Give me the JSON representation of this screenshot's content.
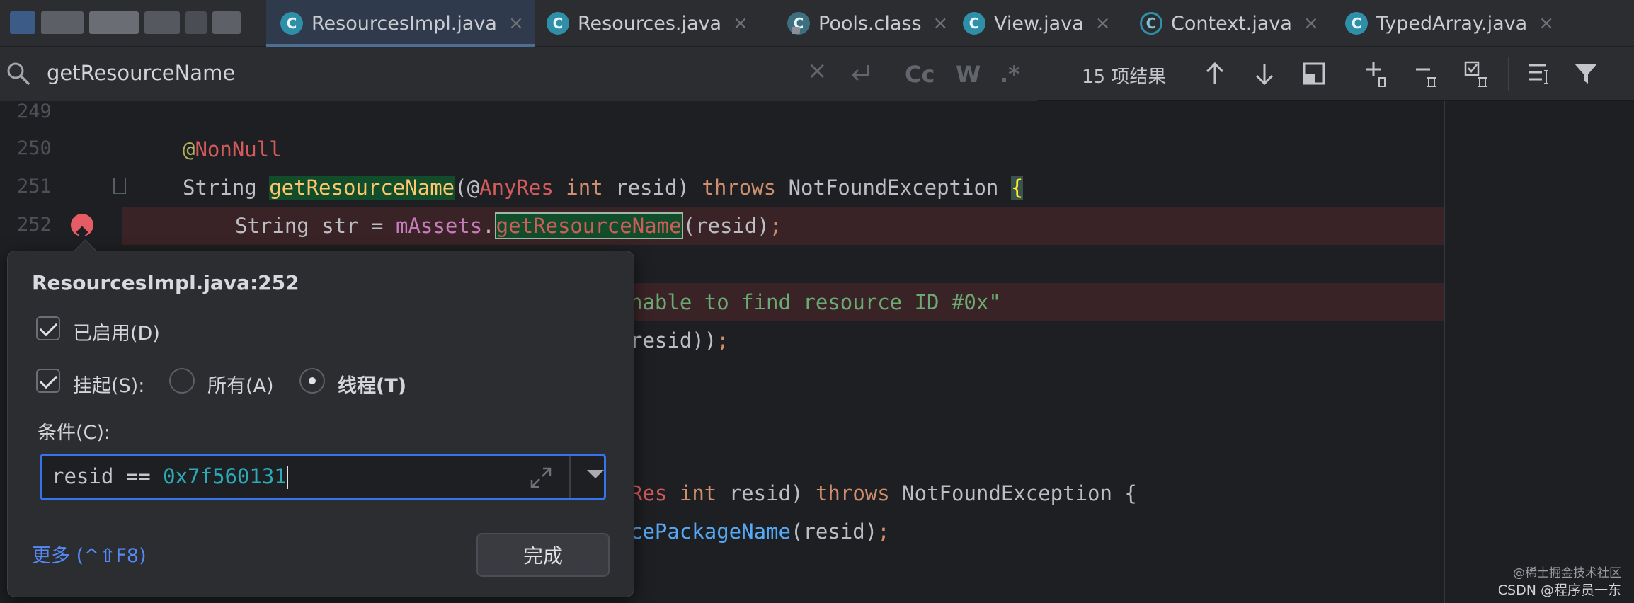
{
  "tabs": [
    {
      "label": "ResourcesImpl.java",
      "icon": "java-class-icon",
      "active": true
    },
    {
      "label": "Resources.java",
      "icon": "java-class-icon"
    },
    {
      "label": "Pools.class",
      "icon": "compiled-class-icon"
    },
    {
      "label": "View.java",
      "icon": "java-class-icon"
    },
    {
      "label": "Context.java",
      "icon": "java-abstract-class-icon"
    },
    {
      "label": "TypedArray.java",
      "icon": "java-class-icon"
    }
  ],
  "tab_icon_letter": "C",
  "search": {
    "query": "getResourceName",
    "result_count": "15 项结果",
    "match_case_label": "Cc",
    "words_label": "W",
    "regex_label": ".*"
  },
  "line_numbers": [
    "249",
    "250",
    "251",
    "252"
  ],
  "code": {
    "l250_at": "@",
    "l250_annotation": "NonNull",
    "l251_type": "String ",
    "l251_method": "getResourceName",
    "l251_open": "(@",
    "l251_annotation": "AnyRes",
    "l251_sp": " ",
    "l251_int": "int",
    "l251_param": " resid) ",
    "l251_throws": "throws",
    "l251_exc": " NotFoundException ",
    "l251_brace": "{",
    "l252_decl": "String str = ",
    "l252_field": "mAssets",
    "l252_dot": ".",
    "l252_call": "getResourceName",
    "l252_args": "(resid)",
    "l252_semi": ";",
    "l254_str": "nable to find resource ID #0x\"",
    "l255_text": "resid))",
    "l255_semi": ";",
    "l259_ann": "Res",
    "l259_sp": " ",
    "l259_int": "int",
    "l259_param": " resid) ",
    "l259_throws": "throws",
    "l259_exc": " NotFoundException {",
    "l260_call": "cePackageName",
    "l260_args": "(resid)",
    "l260_semi": ";"
  },
  "popup": {
    "title": "ResourcesImpl.java:252",
    "enabled_label": "已启用(D)",
    "suspend_label": "挂起(S):",
    "all_label": "所有(A)",
    "thread_label": "线程(T)",
    "condition_label": "条件(C):",
    "condition_prefix": "resid == ",
    "condition_value": "0x7f560131",
    "more_link": "更多 (^⇧F8)",
    "done_button": "完成"
  },
  "watermark": {
    "line1": "@稀土掘金技术社区",
    "line2": "CSDN @程序员一东"
  },
  "colors": {
    "accent_blue": "#3574f0",
    "breakpoint_red": "#e55c64",
    "search_match_green": "#114c2b"
  }
}
